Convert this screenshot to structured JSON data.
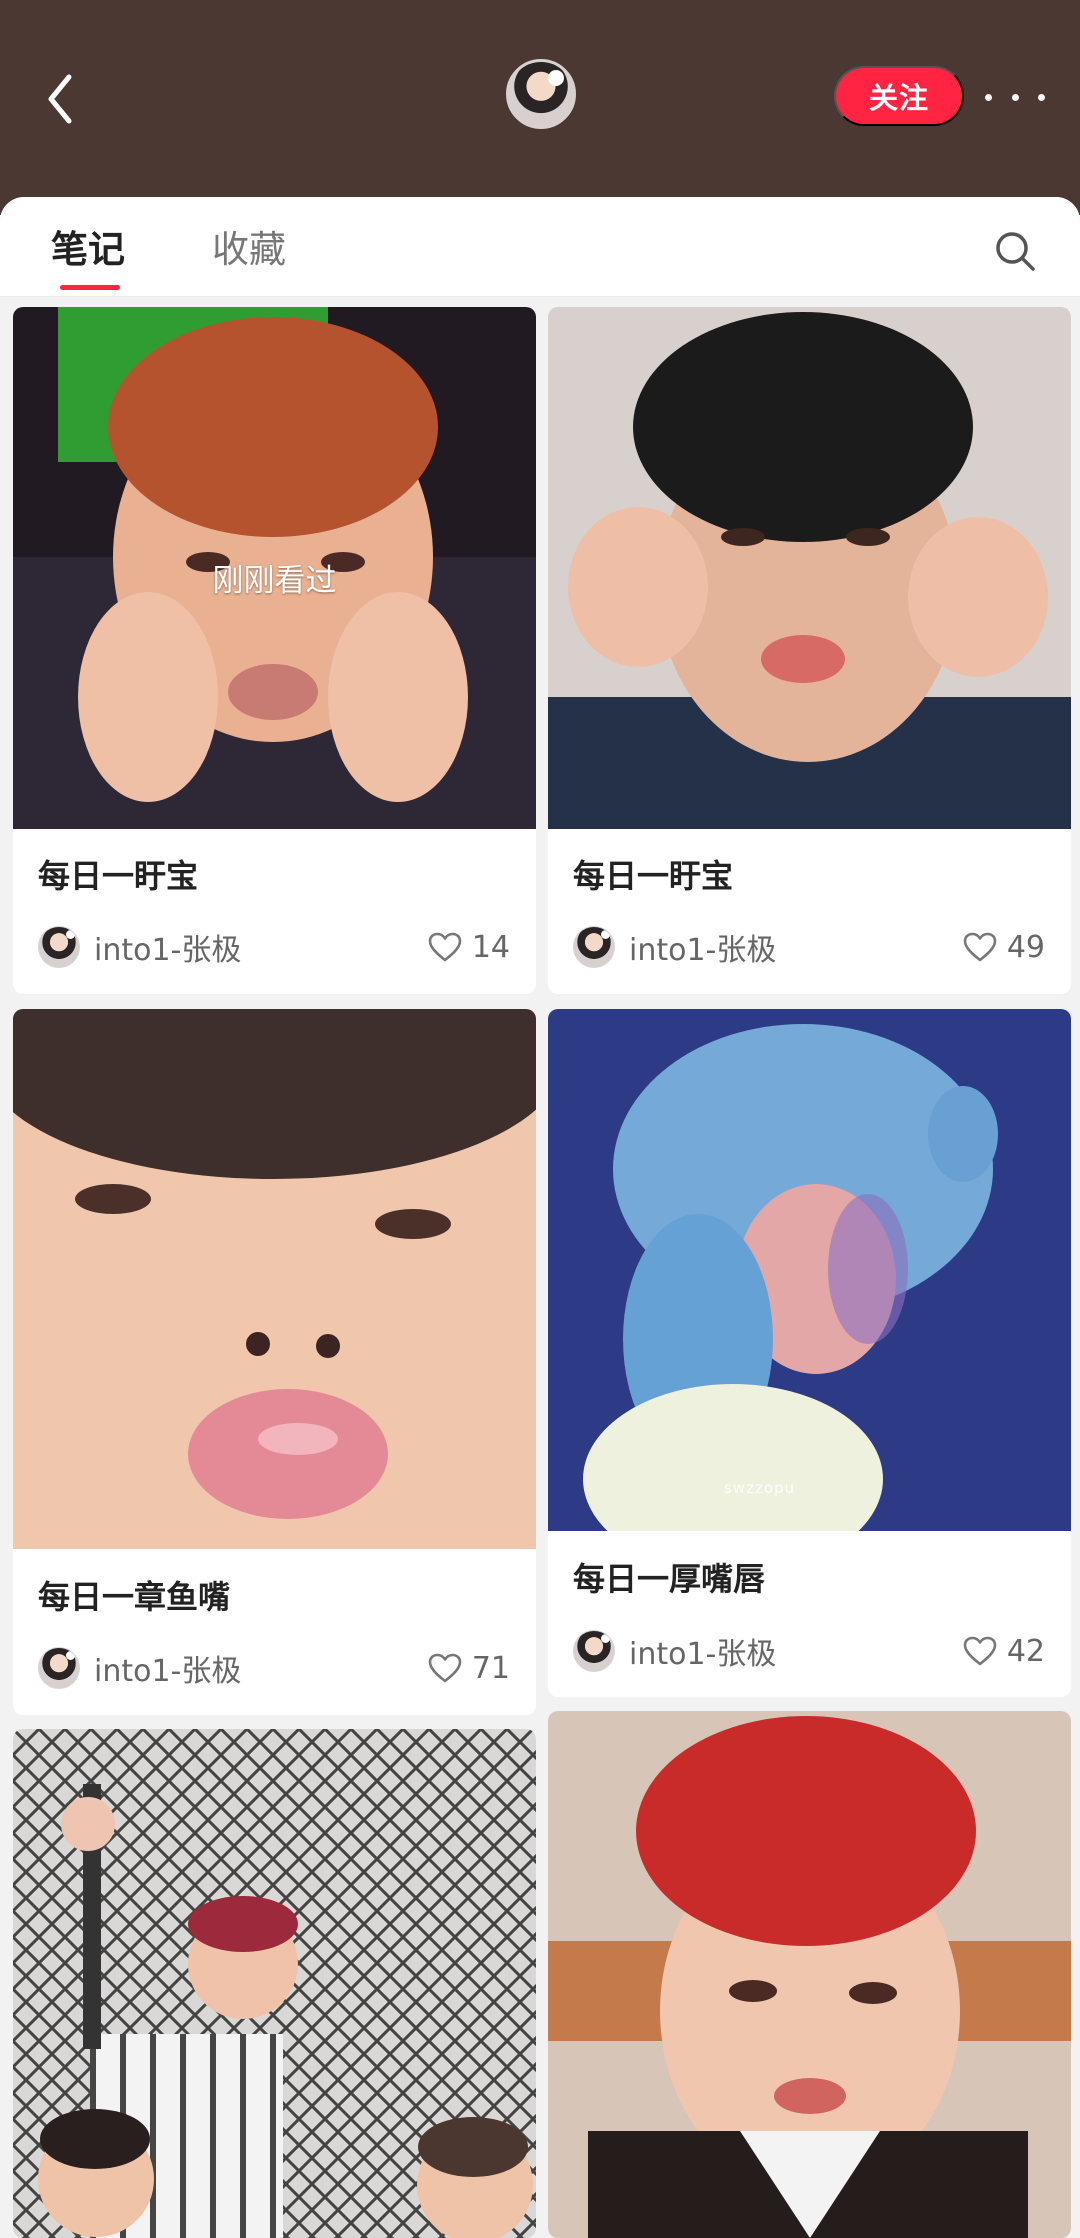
{
  "header": {
    "follow_label": "关注"
  },
  "tabs": {
    "notes": "笔记",
    "collect": "收藏"
  },
  "feed": [
    {
      "title": "每日一盱宝",
      "author": "into1-张极",
      "likes": "14",
      "overlay": "刚刚看过"
    },
    {
      "title": "每日一盱宝",
      "author": "into1-张极",
      "likes": "49"
    },
    {
      "title": "每日一章鱼嘴",
      "author": "into1-张极",
      "likes": "71"
    },
    {
      "title": "每日一厚嘴唇",
      "author": "into1-张极",
      "likes": "42",
      "watermark": "swzzopu"
    }
  ],
  "colors": {
    "header": "#4b3833",
    "accent": "#ff2442"
  },
  "icons": [
    "back-icon",
    "search-icon",
    "heart-icon",
    "more-icon"
  ]
}
